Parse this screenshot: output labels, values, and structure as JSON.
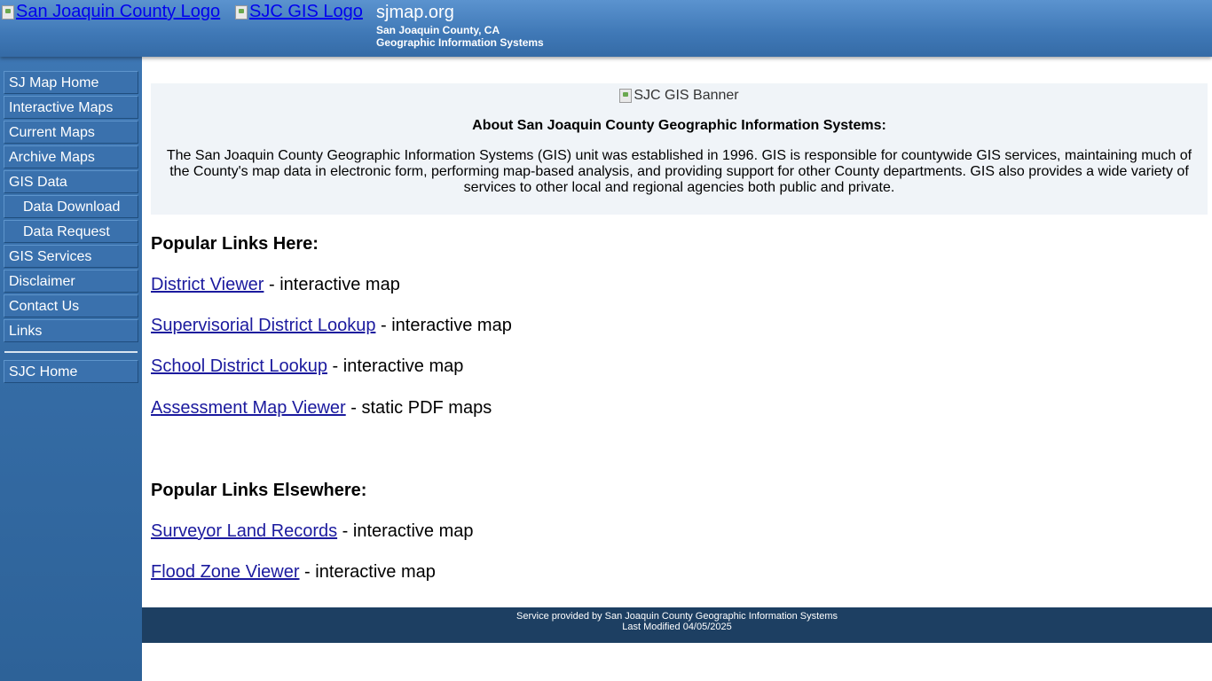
{
  "header": {
    "county_logo_alt": "San Joaquin County Logo",
    "gis_logo_alt": "SJC GIS Logo",
    "site_title": "sjmap.org",
    "subtitle_line1": "San Joaquin County, CA",
    "subtitle_line2": "Geographic Information Systems"
  },
  "sidebar": {
    "items": [
      {
        "label": "SJ Map Home"
      },
      {
        "label": "Interactive Maps"
      },
      {
        "label": "Current Maps"
      },
      {
        "label": "Archive Maps"
      },
      {
        "label": "GIS Data"
      },
      {
        "label": "Data Download"
      },
      {
        "label": "Data Request"
      },
      {
        "label": "GIS Services"
      },
      {
        "label": "Disclaimer"
      },
      {
        "label": "Contact Us"
      },
      {
        "label": "Links"
      }
    ],
    "home_item": {
      "label": "SJC Home"
    }
  },
  "about": {
    "banner_alt": "SJC GIS Banner",
    "heading": "About San Joaquin County Geographic Information Systems:",
    "text": "The San Joaquin County Geographic Information Systems (GIS) unit was established in 1996.  GIS is responsible for countywide GIS services, maintaining much of the County's map data in electronic form, performing map-based analysis, and providing support for other County departments.  GIS also provides a wide variety of services to other local and regional agencies both public and private."
  },
  "popular_here": {
    "heading": "Popular Links Here:",
    "links": [
      {
        "label": "District Viewer",
        "suffix": " - interactive map"
      },
      {
        "label": "Supervisorial District Lookup",
        "suffix": " - interactive map"
      },
      {
        "label": "School District Lookup",
        "suffix": " - interactive map"
      },
      {
        "label": "Assessment Map Viewer",
        "suffix": " - static PDF maps"
      }
    ]
  },
  "popular_elsewhere": {
    "heading": "Popular Links Elsewhere:",
    "links": [
      {
        "label": "Surveyor Land Records",
        "suffix": " - interactive map"
      },
      {
        "label": "Flood Zone Viewer",
        "suffix": " - interactive map"
      }
    ]
  },
  "footer": {
    "line1": "Service provided by San Joaquin County Geographic Information Systems",
    "line2": "Last Modified 04/05/2025"
  },
  "colors": {
    "header_blue": "#3f78b6",
    "sidebar_blue": "#3a71ad",
    "footer_navy": "#1d3f62",
    "link_color": "#1b1a9e",
    "about_bg": "#f0f4f8"
  }
}
